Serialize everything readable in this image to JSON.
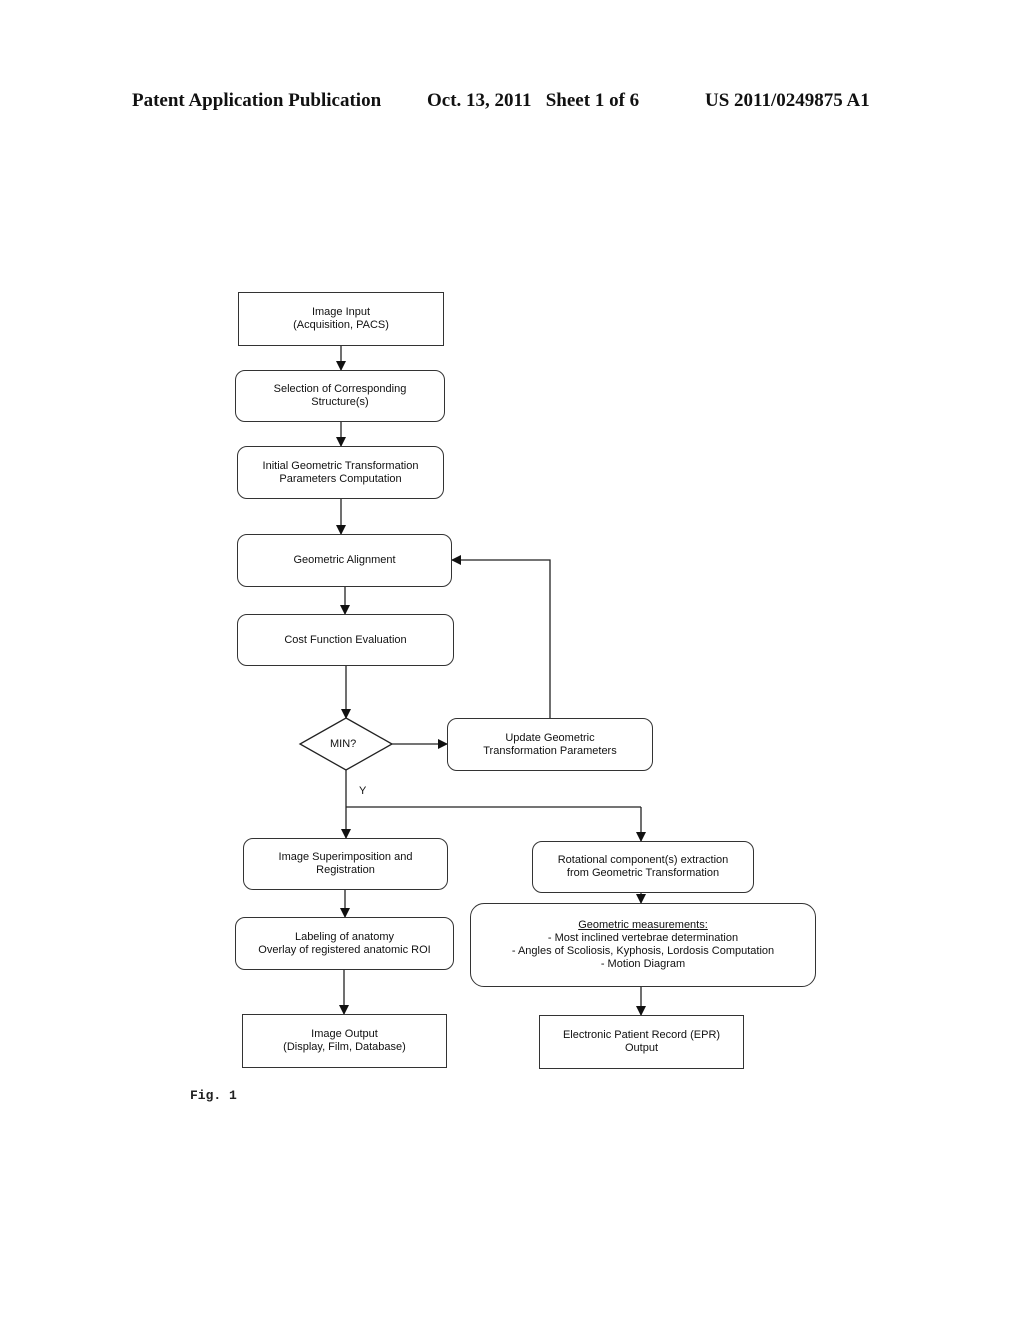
{
  "header": {
    "publication": "Patent Application Publication",
    "date_sheet": "Oct. 13, 2011   Sheet 1 of 6",
    "number": "US 2011/0249875 A1"
  },
  "flowchart": {
    "image_input": [
      "Image Input",
      "(Acquisition, PACS)"
    ],
    "selection": [
      "Selection of Corresponding",
      "Structure(s)"
    ],
    "initial_params": [
      "Initial Geometric Transformation",
      "Parameters Computation"
    ],
    "alignment": [
      "Geometric Alignment"
    ],
    "cost_eval": [
      "Cost Function Evaluation"
    ],
    "decision": "MIN?",
    "update_params": [
      "Update Geometric",
      "Transformation Parameters"
    ],
    "yes_label": "Y",
    "superimposition": [
      "Image Superimposition and",
      "Registration"
    ],
    "labeling": [
      "Labeling of anatomy",
      "Overlay of registered anatomic ROI"
    ],
    "image_output": [
      "Image Output",
      "(Display, Film, Database)"
    ],
    "rotational": [
      "Rotational component(s) extraction",
      "from Geometric Transformation"
    ],
    "measurements": {
      "title": "Geometric measurements:",
      "items": [
        "- Most inclined vertebrae determination",
        "- Angles of Scoliosis, Kyphosis, Lordosis Computation",
        "- Motion Diagram"
      ]
    },
    "epr_output": [
      "Electronic Patient Record (EPR)",
      "Output"
    ]
  },
  "figure_label": "Fig. 1"
}
